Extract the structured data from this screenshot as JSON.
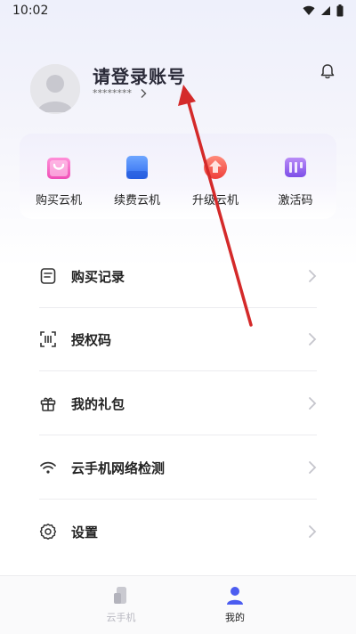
{
  "status_bar": {
    "time": "10:02"
  },
  "header": {
    "login_title": "请登录账号",
    "account_mask": "********"
  },
  "quick_actions": [
    {
      "label": "购买云机",
      "icon": "shopping-bag-icon"
    },
    {
      "label": "续费云机",
      "icon": "card-icon"
    },
    {
      "label": "升级云机",
      "icon": "upgrade-icon"
    },
    {
      "label": "激活码",
      "icon": "activation-code-icon"
    }
  ],
  "menu": [
    {
      "label": "购买记录",
      "icon": "document-icon"
    },
    {
      "label": "授权码",
      "icon": "scan-code-icon"
    },
    {
      "label": "我的礼包",
      "icon": "gift-icon"
    },
    {
      "label": "云手机网络检测",
      "icon": "wifi-icon"
    },
    {
      "label": "设置",
      "icon": "settings-icon"
    }
  ],
  "bottom_nav": [
    {
      "label": "云手机",
      "icon": "cloud-phone-icon",
      "active": false
    },
    {
      "label": "我的",
      "icon": "person-icon",
      "active": true
    }
  ],
  "colors": {
    "accent": "#4b5cf0",
    "nav_inactive": "#b9b9c2",
    "annotation_arrow": "#d42a2a"
  }
}
